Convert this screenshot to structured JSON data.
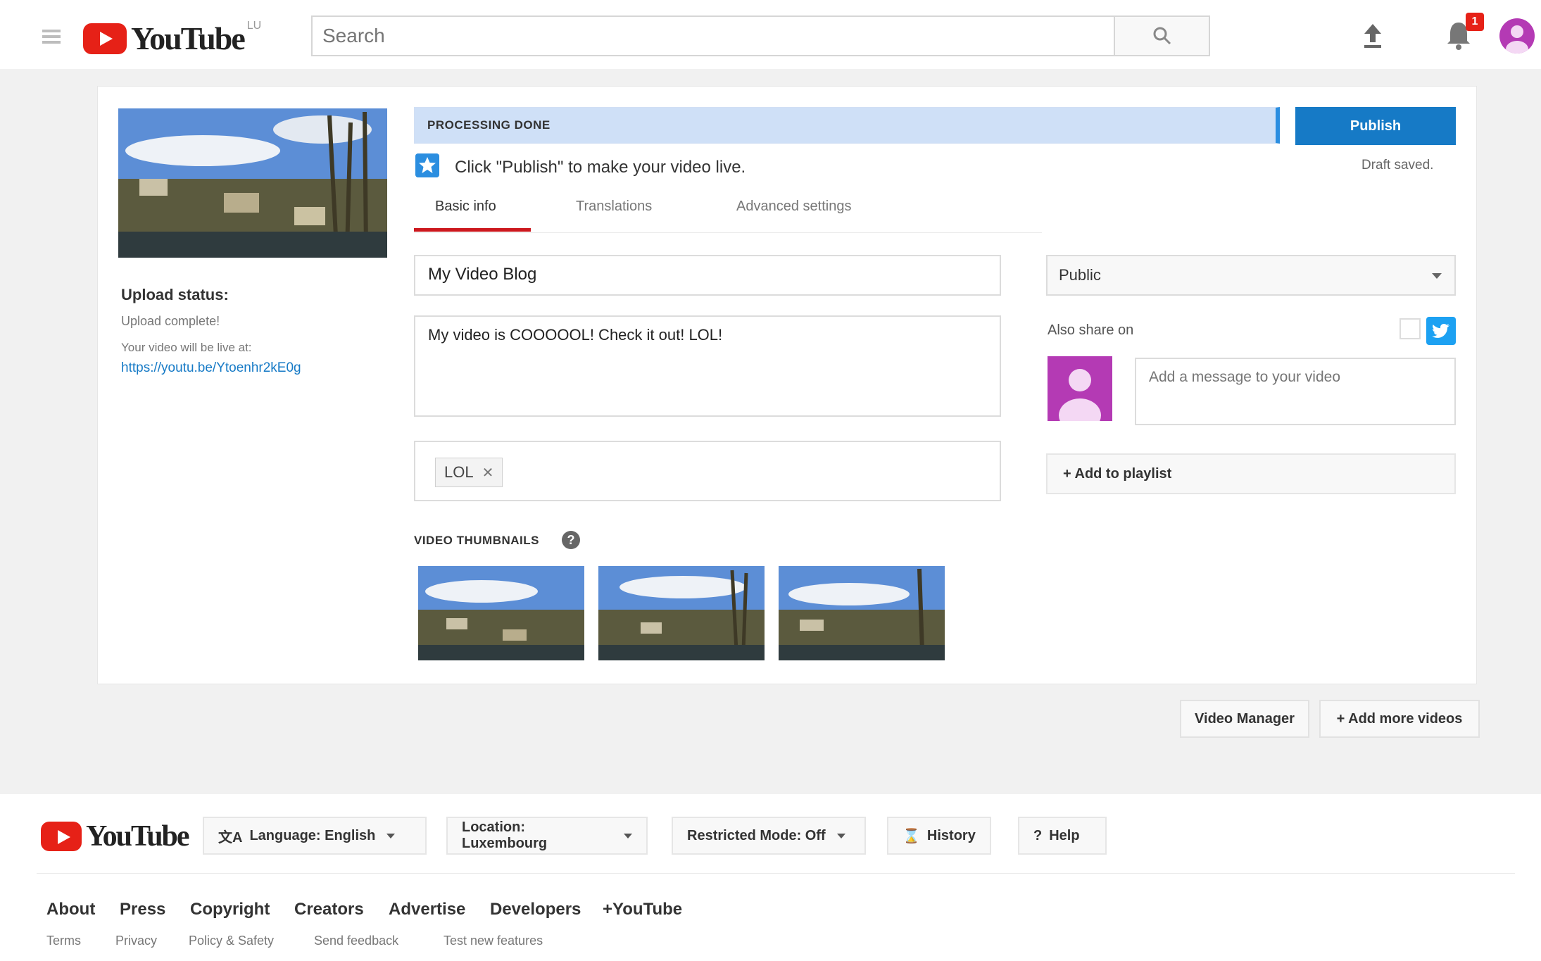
{
  "colors": {
    "brand_red": "#e62117",
    "publish_blue": "#167ac6",
    "twitter_blue": "#1da1f2"
  },
  "masthead": {
    "logo_text": "YouTube",
    "region": "LU",
    "search": {
      "placeholder": "Search"
    },
    "notification_count": "1"
  },
  "upload_panel": {
    "status_title": "Upload status:",
    "status_detail": "Upload complete!",
    "live_text": "Your video will be live at:",
    "video_url": "https://youtu.be/Ytoenhr2kE0g"
  },
  "processing": {
    "text": "PROCESSING DONE",
    "progress": 1.0
  },
  "publish": {
    "button_label": "Publish",
    "draft_label": "Draft saved."
  },
  "notice": {
    "text": "Click \"Publish\" to make your video live."
  },
  "tabs": [
    {
      "label": "Basic info",
      "active": true
    },
    {
      "label": "Translations",
      "active": false
    },
    {
      "label": "Advanced settings",
      "active": false
    }
  ],
  "form": {
    "title": "My Video Blog",
    "description": "My video is COOOOOL! Check it out! LOL!",
    "tags": [
      "LOL"
    ]
  },
  "thumbnails": {
    "label": "VIDEO THUMBNAILS",
    "count": 3
  },
  "sidebar": {
    "privacy": "Public",
    "share_label": "Also share on",
    "message_placeholder": "Add a message to your video",
    "playlist_label": "+ Add to playlist"
  },
  "bottom_actions": {
    "video_manager": "Video Manager",
    "add_more": "+ Add more videos"
  },
  "footer": {
    "logo_text": "YouTube",
    "language": "Language: English",
    "location": "Location: Luxembourg",
    "restricted": "Restricted Mode: Off",
    "history": "History",
    "help": "Help",
    "links": [
      "About",
      "Press",
      "Copyright",
      "Creators",
      "Advertise",
      "Developers",
      "+YouTube"
    ],
    "sub_links": [
      "Terms",
      "Privacy",
      "Policy & Safety",
      "Send feedback",
      "Test new features"
    ]
  }
}
